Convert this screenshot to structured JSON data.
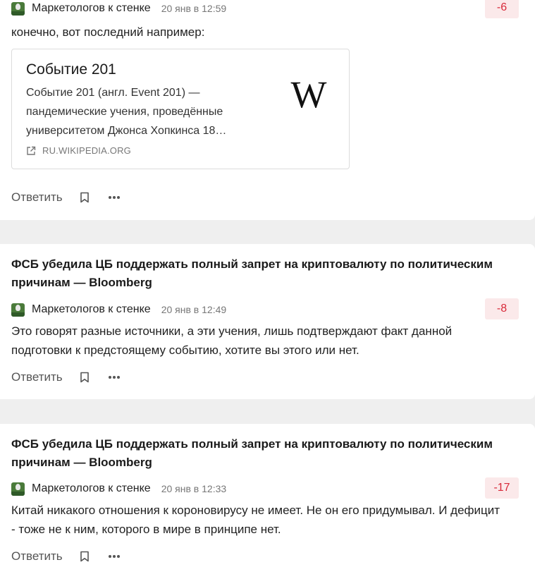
{
  "comments": [
    {
      "post_title": "",
      "author": "Маркетологов к стенке",
      "date": "20 янв в 12:59",
      "rating": "-6",
      "text": "конечно, вот последний например:",
      "link_preview": {
        "title": "Событие 201",
        "description": "Событие 201 (англ. Event 201) — пандемические учения, проведённые университетом Джонса Хопкинса 18…",
        "domain": "RU.WIKIPEDIA.ORG",
        "logo_glyph": "W"
      },
      "reply_label": "Ответить"
    },
    {
      "post_title": "ФСБ убедила ЦБ поддержать полный запрет на криптовалюту по политическим причинам — Bloomberg",
      "author": "Маркетологов к стенке",
      "date": "20 янв в 12:49",
      "rating": "-8",
      "text": "Это говорят разные источники, а эти учения, лишь подтверждают факт данной подготовки к предстоящему событию, хотите вы этого или нет.",
      "reply_label": "Ответить"
    },
    {
      "post_title": "ФСБ убедила ЦБ поддержать полный запрет на криптовалюту по политическим причинам — Bloomberg",
      "author": "Маркетологов к стенке",
      "date": "20 янв в 12:33",
      "rating": "-17",
      "text": "Китай никакого отношения к короновирусу не имеет. Не он его придумывал. И дефицит - тоже не к ним, которого в мире в принципе нет.",
      "reply_label": "Ответить"
    }
  ],
  "icons": {
    "avatar": "avatar-image",
    "bookmark": "bookmark-icon",
    "more": "more-dots-icon",
    "external_link": "external-link-icon"
  },
  "colors": {
    "rating_text": "#d82a3a",
    "rating_bg": "#fbe9ea",
    "page_bg": "#efefef"
  }
}
